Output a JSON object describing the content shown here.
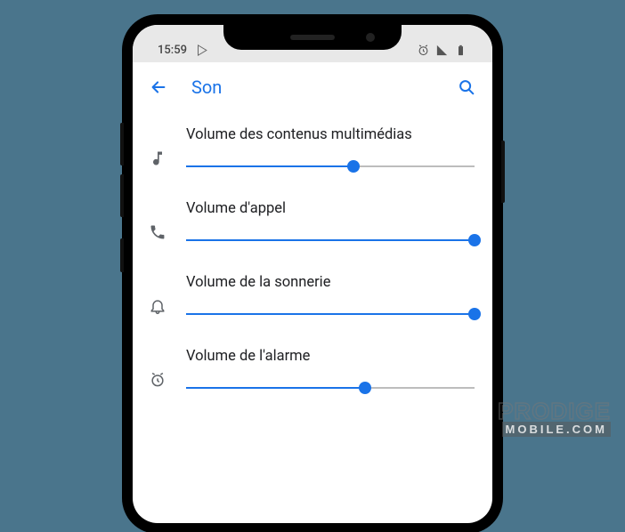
{
  "status": {
    "time": "15:59"
  },
  "header": {
    "title": "Son"
  },
  "sliders": [
    {
      "label": "Volume des contenus multimédias",
      "value": 58,
      "icon": "music-note"
    },
    {
      "label": "Volume d'appel",
      "value": 100,
      "icon": "phone"
    },
    {
      "label": "Volume de la sonnerie",
      "value": 100,
      "icon": "bell"
    },
    {
      "label": "Volume de l'alarme",
      "value": 62,
      "icon": "alarm"
    }
  ],
  "watermark": {
    "line1": "PRODIGE",
    "line2": "MOBILE.COM"
  }
}
